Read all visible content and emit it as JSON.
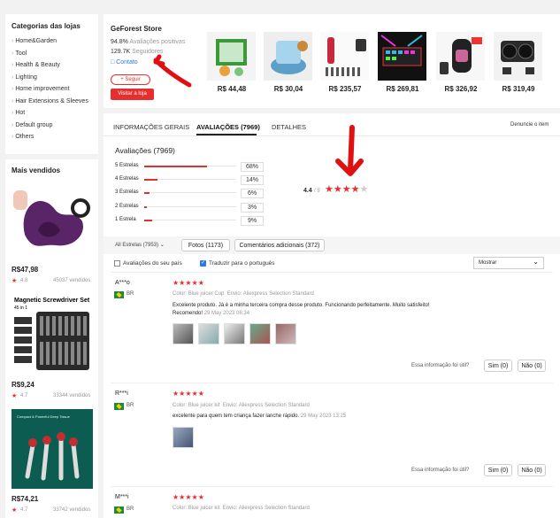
{
  "sidebar": {
    "title": "Categorias das lojas",
    "categories": [
      "Home&Garden",
      "Tool",
      "Health & Beauty",
      "Lighting",
      "Home improvement",
      "Hair Extensions & Sleeves",
      "Hot",
      "Default group",
      "Others"
    ],
    "bestsellers_title": "Mais vendidos",
    "bestsellers": [
      {
        "price": "R$47,98",
        "rating": "4.8",
        "sold": "45037 vendidos"
      },
      {
        "price": "R$9,24",
        "rating": "4.7",
        "sold": "33344 vendidos",
        "image_title": "Magnetic Screwdriver Set",
        "image_sub": "45 in 1"
      },
      {
        "price": "R$74,21",
        "rating": "4.7",
        "sold": "33742 vendidos",
        "image_title": "Compact & Powerful Deep Tissue"
      }
    ]
  },
  "store": {
    "name": "GeForest Store",
    "positive_pct": "94.8%",
    "positive_label": "Avaliações positivas",
    "followers_count": "129.7K",
    "followers_label": "Seguidores",
    "contact_label": "Contato",
    "follow_label": "+ Seguir",
    "visit_label": "Visitar a loja",
    "products": [
      {
        "price": "R$ 44,48",
        "icon": "vegetable-cutter"
      },
      {
        "price": "R$ 30,04",
        "icon": "chopper-bowl"
      },
      {
        "price": "R$ 235,57",
        "icon": "massager-set"
      },
      {
        "price": "R$ 269,81",
        "icon": "led-keyboard"
      },
      {
        "price": "R$ 326,92",
        "icon": "device"
      },
      {
        "price": "R$ 319,49",
        "icon": "binoculars"
      }
    ]
  },
  "tabs": {
    "items": [
      "INFORMAÇÕES GERAIS",
      "AVALIAÇÕES (7969)",
      "DETALHES"
    ],
    "active_index": 1,
    "report_label": "Denuncie o item"
  },
  "reviews": {
    "heading": "Avaliações (7969)",
    "rating_value": "4.4",
    "rating_max": "/ 5",
    "breakdown": [
      {
        "label": "5 Estrelas",
        "pct": "68%",
        "fraction": 0.68
      },
      {
        "label": "4 Estrelas",
        "pct": "14%",
        "fraction": 0.14
      },
      {
        "label": "3 Estrelas",
        "pct": "6%",
        "fraction": 0.06
      },
      {
        "label": "2 Estrelas",
        "pct": "3%",
        "fraction": 0.03
      },
      {
        "label": "1 Estrela",
        "pct": "9%",
        "fraction": 0.09
      }
    ],
    "filter_all": "All Estrelas (7953)",
    "filter_photos": "Fotos (1173)",
    "filter_comments": "Comentários adicionais (372)",
    "check_country": "Avaliações do seu país",
    "check_translate": "Traduzir para o português",
    "sort_label": "Mostrar",
    "helpful_label": "Essa informação foi útil?",
    "yes_label": "Sim (0)",
    "no_label": "Não (0)",
    "items": [
      {
        "user": "A***o",
        "country": "BR",
        "color_label": "Color:",
        "color_value": "Blue juicer Cup",
        "ship_label": "Envio:",
        "ship_value": "Aliexpress Selection Standard",
        "text": "Excelente produto. Já é a minha terceira compra desse produto. Funcionando perfeitamente. Muito satisfeito!",
        "extra": "Recomendo!",
        "date": "29 May 2023 06:34"
      },
      {
        "user": "R***i",
        "country": "BR",
        "color_label": "Color:",
        "color_value": "Blue juicer kit",
        "ship_label": "Envio:",
        "ship_value": "Aliexpress Selection Standard",
        "text": "excelente para quem tem criança fazer lanche rápido.",
        "date": "29 May 2023 13:25"
      },
      {
        "user": "M***i",
        "country": "BR",
        "color_label": "Color:",
        "color_value": "Blue juicer kit",
        "ship_label": "Envio:",
        "ship_value": "Aliexpress Selection Standard"
      }
    ]
  },
  "colors": {
    "accent": "#e62e2e",
    "annotation_arrow": "#e01010"
  }
}
